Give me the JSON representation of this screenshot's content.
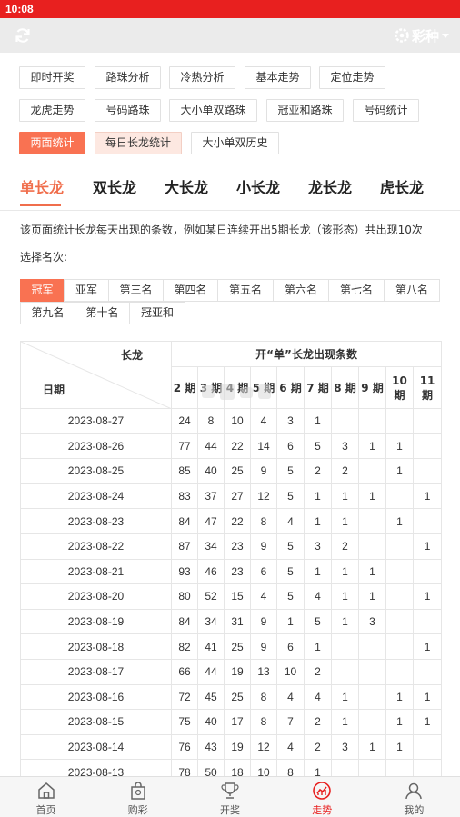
{
  "status_bar": {
    "time": "10:08"
  },
  "header": {
    "lottery_label": "彩种"
  },
  "nav_chips": [
    {
      "label": "即时开奖"
    },
    {
      "label": "路珠分析"
    },
    {
      "label": "冷热分析"
    },
    {
      "label": "基本走势"
    },
    {
      "label": "定位走势"
    },
    {
      "label": "龙虎走势"
    },
    {
      "label": "号码路珠"
    },
    {
      "label": "大小单双路珠"
    },
    {
      "label": "冠亚和路珠"
    },
    {
      "label": "号码统计"
    },
    {
      "label": "两面统计"
    },
    {
      "label": "每日长龙统计"
    },
    {
      "label": "大小单双历史"
    }
  ],
  "dragon_tabs": [
    "单长龙",
    "双长龙",
    "大长龙",
    "小长龙",
    "龙长龙",
    "虎长龙"
  ],
  "description": "该页面统计长龙每天出现的条数，例如某日连续开出5期长龙（该形态）共出现10次",
  "select_label": "选择名次:",
  "positions": [
    "冠军",
    "亚军",
    "第三名",
    "第四名",
    "第五名",
    "第六名",
    "第七名",
    "第八名",
    "第九名",
    "第十名",
    "冠亚和"
  ],
  "table": {
    "corner_top": "长龙",
    "corner_bottom": "日期",
    "group_header": "开“单”长龙出现条数",
    "periods": [
      "2 期",
      "3 期",
      "4 期",
      "5 期",
      "6 期",
      "7 期",
      "8 期",
      "9 期",
      "10 期",
      "11 期"
    ],
    "rows": [
      {
        "date": "2023-08-27",
        "v": [
          "24",
          "8",
          "10",
          "4",
          "3",
          "1",
          "",
          "",
          "",
          ""
        ]
      },
      {
        "date": "2023-08-26",
        "v": [
          "77",
          "44",
          "22",
          "14",
          "6",
          "5",
          "3",
          "1",
          "1",
          ""
        ]
      },
      {
        "date": "2023-08-25",
        "v": [
          "85",
          "40",
          "25",
          "9",
          "5",
          "2",
          "2",
          "",
          "1",
          ""
        ]
      },
      {
        "date": "2023-08-24",
        "v": [
          "83",
          "37",
          "27",
          "12",
          "5",
          "1",
          "1",
          "1",
          "",
          "1"
        ]
      },
      {
        "date": "2023-08-23",
        "v": [
          "84",
          "47",
          "22",
          "8",
          "4",
          "1",
          "1",
          "",
          "1",
          ""
        ]
      },
      {
        "date": "2023-08-22",
        "v": [
          "87",
          "34",
          "23",
          "9",
          "5",
          "3",
          "2",
          "",
          "",
          "1"
        ]
      },
      {
        "date": "2023-08-21",
        "v": [
          "93",
          "46",
          "23",
          "6",
          "5",
          "1",
          "1",
          "1",
          "",
          ""
        ]
      },
      {
        "date": "2023-08-20",
        "v": [
          "80",
          "52",
          "15",
          "4",
          "5",
          "4",
          "1",
          "1",
          "",
          "1"
        ]
      },
      {
        "date": "2023-08-19",
        "v": [
          "84",
          "34",
          "31",
          "9",
          "1",
          "5",
          "1",
          "3",
          "",
          ""
        ]
      },
      {
        "date": "2023-08-18",
        "v": [
          "82",
          "41",
          "25",
          "9",
          "6",
          "1",
          "",
          "",
          "",
          "1"
        ]
      },
      {
        "date": "2023-08-17",
        "v": [
          "66",
          "44",
          "19",
          "13",
          "10",
          "2",
          "",
          "",
          "",
          ""
        ]
      },
      {
        "date": "2023-08-16",
        "v": [
          "72",
          "45",
          "25",
          "8",
          "4",
          "4",
          "1",
          "",
          "1",
          "1"
        ]
      },
      {
        "date": "2023-08-15",
        "v": [
          "75",
          "40",
          "17",
          "8",
          "7",
          "2",
          "1",
          "",
          "1",
          "1"
        ]
      },
      {
        "date": "2023-08-14",
        "v": [
          "76",
          "43",
          "19",
          "12",
          "4",
          "2",
          "3",
          "1",
          "1",
          ""
        ]
      },
      {
        "date": "2023-08-13",
        "v": [
          "78",
          "50",
          "18",
          "10",
          "8",
          "1",
          "",
          "",
          "",
          ""
        ]
      }
    ]
  },
  "tab_bar": [
    {
      "label": "首页",
      "icon": "home-icon"
    },
    {
      "label": "购彩",
      "icon": "bag-icon"
    },
    {
      "label": "开奖",
      "icon": "trophy-icon"
    },
    {
      "label": "走势",
      "icon": "chart-icon",
      "active": true
    },
    {
      "label": "我的",
      "icon": "user-icon"
    }
  ],
  "colors": {
    "status_bar": "#e8201f",
    "accent": "#f97252",
    "active_text": "#f06e4c"
  }
}
